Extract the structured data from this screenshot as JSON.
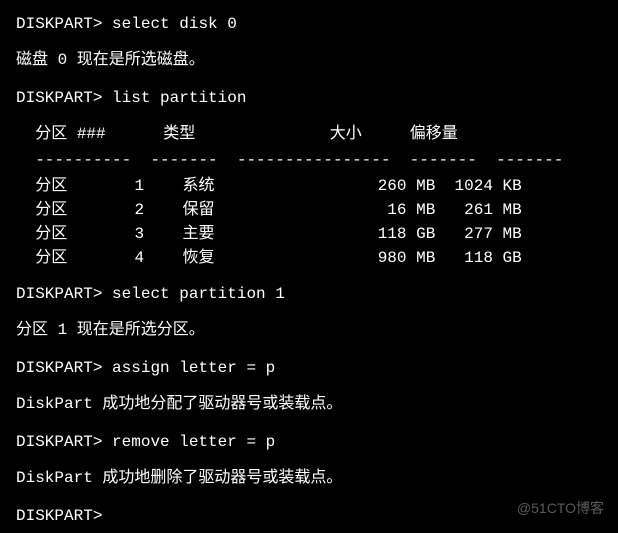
{
  "prompt": "DISKPART>",
  "cmd1": "select disk 0",
  "resp1": "磁盘 0 现在是所选磁盘。",
  "cmd2": "list partition",
  "headers": {
    "partition": "分区",
    "hash": "###",
    "type": "类型",
    "size": "大小",
    "offset": "偏移量"
  },
  "divider": {
    "d1": "----------",
    "d2": "-------",
    "d3": "----------------",
    "d4": "-------",
    "d5": "-------"
  },
  "rows": [
    {
      "label": "分区",
      "num": "1",
      "type": "系统",
      "size": "260 MB",
      "offset": "1024 KB"
    },
    {
      "label": "分区",
      "num": "2",
      "type": "保留",
      "size": "16 MB",
      "offset": "261 MB"
    },
    {
      "label": "分区",
      "num": "3",
      "type": "主要",
      "size": "118 GB",
      "offset": "277 MB"
    },
    {
      "label": "分区",
      "num": "4",
      "type": "恢复",
      "size": "980 MB",
      "offset": "118 GB"
    }
  ],
  "cmd3": "select partition 1",
  "resp3": "分区 1 现在是所选分区。",
  "cmd4": "assign letter = p",
  "resp4": "DiskPart 成功地分配了驱动器号或装载点。",
  "cmd5": "remove letter = p",
  "resp5": "DiskPart 成功地删除了驱动器号或装载点。",
  "watermark": "@51CTO博客"
}
